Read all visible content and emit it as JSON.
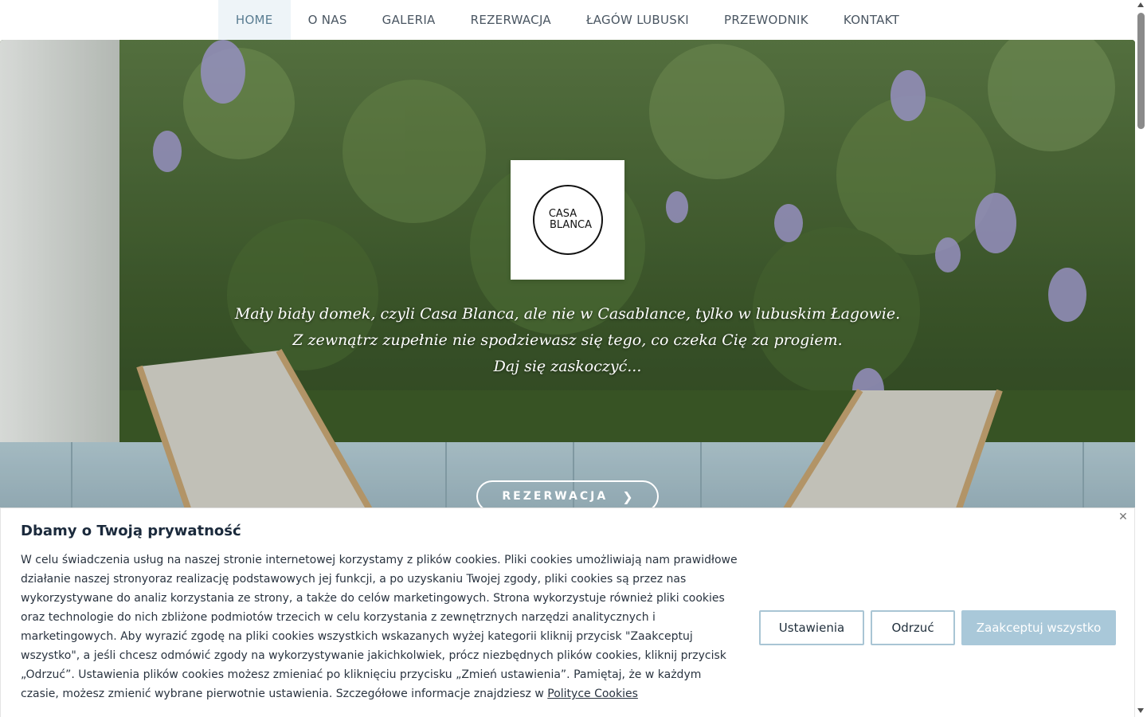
{
  "nav": {
    "items": [
      {
        "label": "HOME",
        "active": true
      },
      {
        "label": "O NAS"
      },
      {
        "label": "GALERIA"
      },
      {
        "label": "REZERWACJA"
      },
      {
        "label": "ŁAGÓW LUBUSKI"
      },
      {
        "label": "PRZEWODNIK"
      },
      {
        "label": "KONTAKT"
      }
    ]
  },
  "hero": {
    "logo_line1": "CASA",
    "logo_line2": "BLANCA",
    "tagline": [
      "Mały biały domek, czyli Casa Blanca, ale nie w Casablance, tylko w lubuskim Łagowie.",
      "Z zewnątrz zupełnie nie spodziewasz się tego, co czeka Cię za progiem.",
      "Daj się zaskoczyć..."
    ],
    "cta_label": "REZERWACJA",
    "cta_icon": "chevron-right-icon"
  },
  "cookie": {
    "title": "Dbamy o Twoją prywatność",
    "text": "W celu świadczenia usług na naszej stronie internetowej korzystamy z plików cookies. Pliki cookies umożliwiają nam prawidłowe działanie naszej stronyoraz realizację podstawowych jej funkcji, a po uzyskaniu Twojej zgody, pliki cookies są przez nas wykorzystywane do analiz korzystania ze strony, a także do celów marketingowych. Strona wykorzystuje również pliki cookies oraz technologie do nich zbliżone podmiotów trzecich w celu korzystania z zewnętrznych narzędzi analitycznych i marketingowych. Aby wyrazić zgodę na pliki cookies wszystkich wskazanych wyżej kategorii kliknij przycisk \"Zaakceptuj wszystko\", a jeśli chcesz odmówić zgody na wykorzystywanie jakichkolwiek, prócz niezbędnych plików cookies, kliknij przycisk „Odrzuć”. Ustawienia plików cookies możesz zmieniać po kliknięciu przycisku „Zmień ustawienia”. Pamiętaj, że w każdym czasie, możesz zmienić wybrane pierwotnie ustawienia. Szczegółowe informacje znajdziesz w",
    "policy_link": "Polityce Cookies",
    "settings_label": "Ustawienia",
    "reject_label": "Odrzuć",
    "accept_label": "Zaakceptuj wszystko",
    "close_icon": "close-icon"
  },
  "colors": {
    "nav_active_bg": "#eef4f8",
    "accent_button": "#a9c8d9",
    "button_border": "#a9c5d4",
    "title_text": "#1b2a3c"
  }
}
